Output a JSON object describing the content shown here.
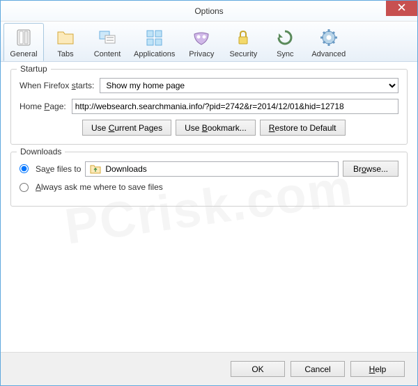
{
  "window": {
    "title": "Options"
  },
  "toolbar": {
    "items": [
      {
        "label": "General"
      },
      {
        "label": "Tabs"
      },
      {
        "label": "Content"
      },
      {
        "label": "Applications"
      },
      {
        "label": "Privacy"
      },
      {
        "label": "Security"
      },
      {
        "label": "Sync"
      },
      {
        "label": "Advanced"
      }
    ]
  },
  "startup": {
    "title": "Startup",
    "when_label": "When Firefox starts:",
    "when_value": "Show my home page",
    "homepage_label": "Home Page:",
    "homepage_value": "http://websearch.searchmania.info/?pid=2742&r=2014/12/01&hid=12718",
    "use_current": "Use Current Pages",
    "use_bookmark": "Use Bookmark...",
    "restore_default": "Restore to Default"
  },
  "downloads": {
    "title": "Downloads",
    "save_to_label": "Save files to",
    "save_path": "Downloads",
    "browse": "Browse...",
    "always_ask": "Always ask me where to save files"
  },
  "footer": {
    "ok": "OK",
    "cancel": "Cancel",
    "help": "Help"
  },
  "watermark": "PCrisk.com"
}
